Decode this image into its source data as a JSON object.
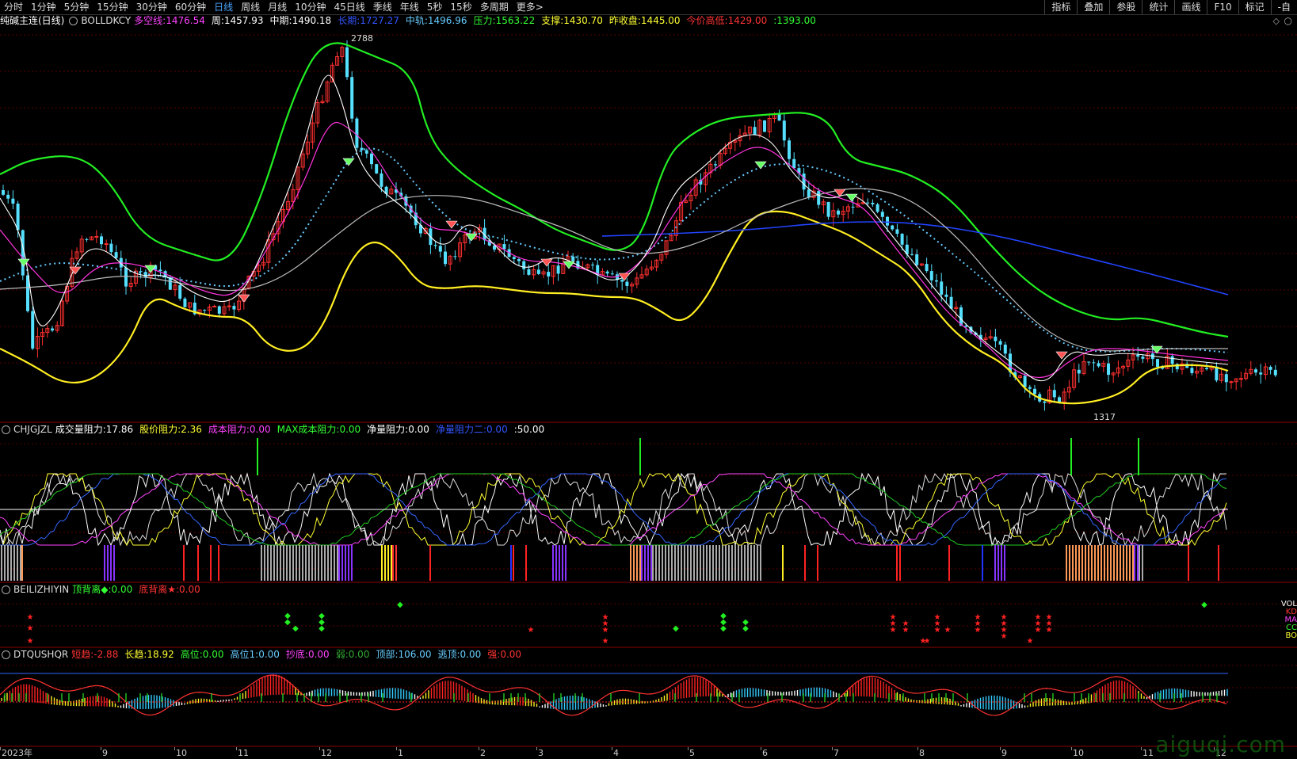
{
  "toolbar": {
    "periods": [
      "分时",
      "1分钟",
      "5分钟",
      "15分钟",
      "30分钟",
      "60分钟",
      "日线",
      "周线",
      "月线",
      "10分钟",
      "45日线",
      "季线",
      "年线",
      "5秒",
      "15秒",
      "多周期",
      "更多>"
    ],
    "active_index": 6,
    "right_tools": [
      "指标",
      "叠加",
      "参股",
      "统计",
      "画线",
      "F10",
      "标记",
      "-自"
    ]
  },
  "main_panel": {
    "name": "纯碱主连(日线)",
    "indicator": "BOLLDKCY",
    "fields": [
      {
        "label": "多空线:",
        "value": "1476.54",
        "color": "#ff44ff"
      },
      {
        "label": "周:",
        "value": "1457.93",
        "color": "#ffffff"
      },
      {
        "label": "中期:",
        "value": "1490.18",
        "color": "#ffffff"
      },
      {
        "label": "长期:",
        "value": "1727.27",
        "color": "#3355ff"
      },
      {
        "label": "中轨:",
        "value": "1496.96",
        "color": "#66ccff"
      },
      {
        "label": "压力:",
        "value": "1563.22",
        "color": "#33ff33"
      },
      {
        "label": "支撑:",
        "value": "1430.70",
        "color": "#ffff33"
      },
      {
        "label": "昨收盘:",
        "value": "1445.00",
        "color": "#ffff33"
      },
      {
        "label": "今价高低:",
        "value": "1429.00",
        "color": "#ff3333"
      },
      {
        "label": ":",
        "value": "1393.00",
        "color": "#33ff33"
      }
    ],
    "high_label": "2788",
    "low_label": "1317"
  },
  "panel2": {
    "indicator": "CHJGJZL",
    "fields": [
      {
        "label": "成交量阻力:",
        "value": "17.86",
        "color": "#ffffff"
      },
      {
        "label": "股价阻力:",
        "value": "2.36",
        "color": "#ffff33"
      },
      {
        "label": "成本阻力:",
        "value": "0.00",
        "color": "#ff44ff"
      },
      {
        "label": "MAX成本阻力:",
        "value": "0.00",
        "color": "#33ff33"
      },
      {
        "label": "净量阻力:",
        "value": "0.00",
        "color": "#ffffff"
      },
      {
        "label": "净量阻力二:",
        "value": "0.00",
        "color": "#3355ff"
      },
      {
        "label": ":",
        "value": "50.00",
        "color": "#ffffff"
      }
    ]
  },
  "panel3": {
    "indicator": "BEILIZHIYIN",
    "fields": [
      {
        "label": "顶背离◆:",
        "value": "0.00",
        "color": "#33ff33"
      },
      {
        "label": "底背离★:",
        "value": "0.00",
        "color": "#ff3333"
      }
    ],
    "right_labels": [
      {
        "text": "VOL",
        "color": "#ffffff"
      },
      {
        "text": "KD",
        "color": "#ff3333"
      },
      {
        "text": "MA",
        "color": "#ff44ff"
      },
      {
        "text": "CC",
        "color": "#33ff33"
      },
      {
        "text": "BO",
        "color": "#ffff33"
      }
    ]
  },
  "panel4": {
    "indicator": "DTQUSHQR",
    "fields": [
      {
        "label": "短趋:",
        "value": "-2.88",
        "color": "#ff3333"
      },
      {
        "label": "长趋:",
        "value": "18.92",
        "color": "#ffff33"
      },
      {
        "label": "高位:",
        "value": "0.00",
        "color": "#33ff33"
      },
      {
        "label": "高位1:",
        "value": "0.00",
        "color": "#66ccff"
      },
      {
        "label": "抄底:",
        "value": "0.00",
        "color": "#ff44ff"
      },
      {
        "label": "弱:",
        "value": "0.00",
        "color": "#33aa33"
      },
      {
        "label": "顶部:",
        "value": "106.00",
        "color": "#66ccff"
      },
      {
        "label": "逃顶:",
        "value": "0.00",
        "color": "#66ccff"
      },
      {
        "label": "强:",
        "value": "0.00",
        "color": "#ff3333"
      }
    ]
  },
  "date_axis": [
    "2023年",
    "9",
    "10",
    "11",
    "12",
    "1",
    "2",
    "3",
    "4",
    "5",
    "6",
    "7",
    "8",
    "9",
    "10",
    "11",
    "12"
  ],
  "watermark": "aiguqi.com"
}
